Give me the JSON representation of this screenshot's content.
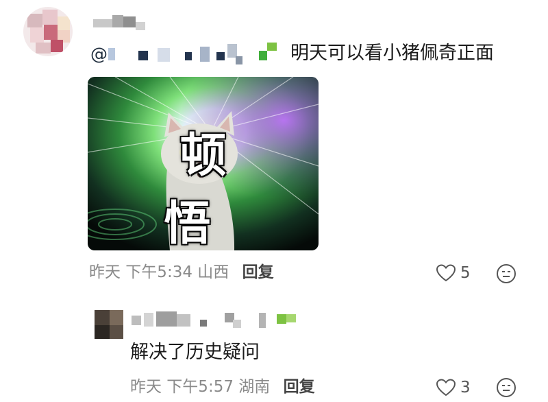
{
  "comments": [
    {
      "mention_prefix": "@",
      "text": "明天可以看小猪佩奇正面",
      "meme_caption": "顿 悟",
      "time": "昨天 下午5:34",
      "location": "山西",
      "reply_label": "回复",
      "like_count": "5"
    },
    {
      "text": "解决了历史疑问",
      "time": "昨天 下午5:57",
      "location": "湖南",
      "reply_label": "回复",
      "like_count": "3"
    }
  ],
  "icons": {
    "like": "heart-outline-icon",
    "reaction": "neutral-face-icon"
  },
  "colors": {
    "meta_text": "#8a8a8a",
    "text": "#1b1b1b",
    "censor_green": "#7dc242"
  }
}
